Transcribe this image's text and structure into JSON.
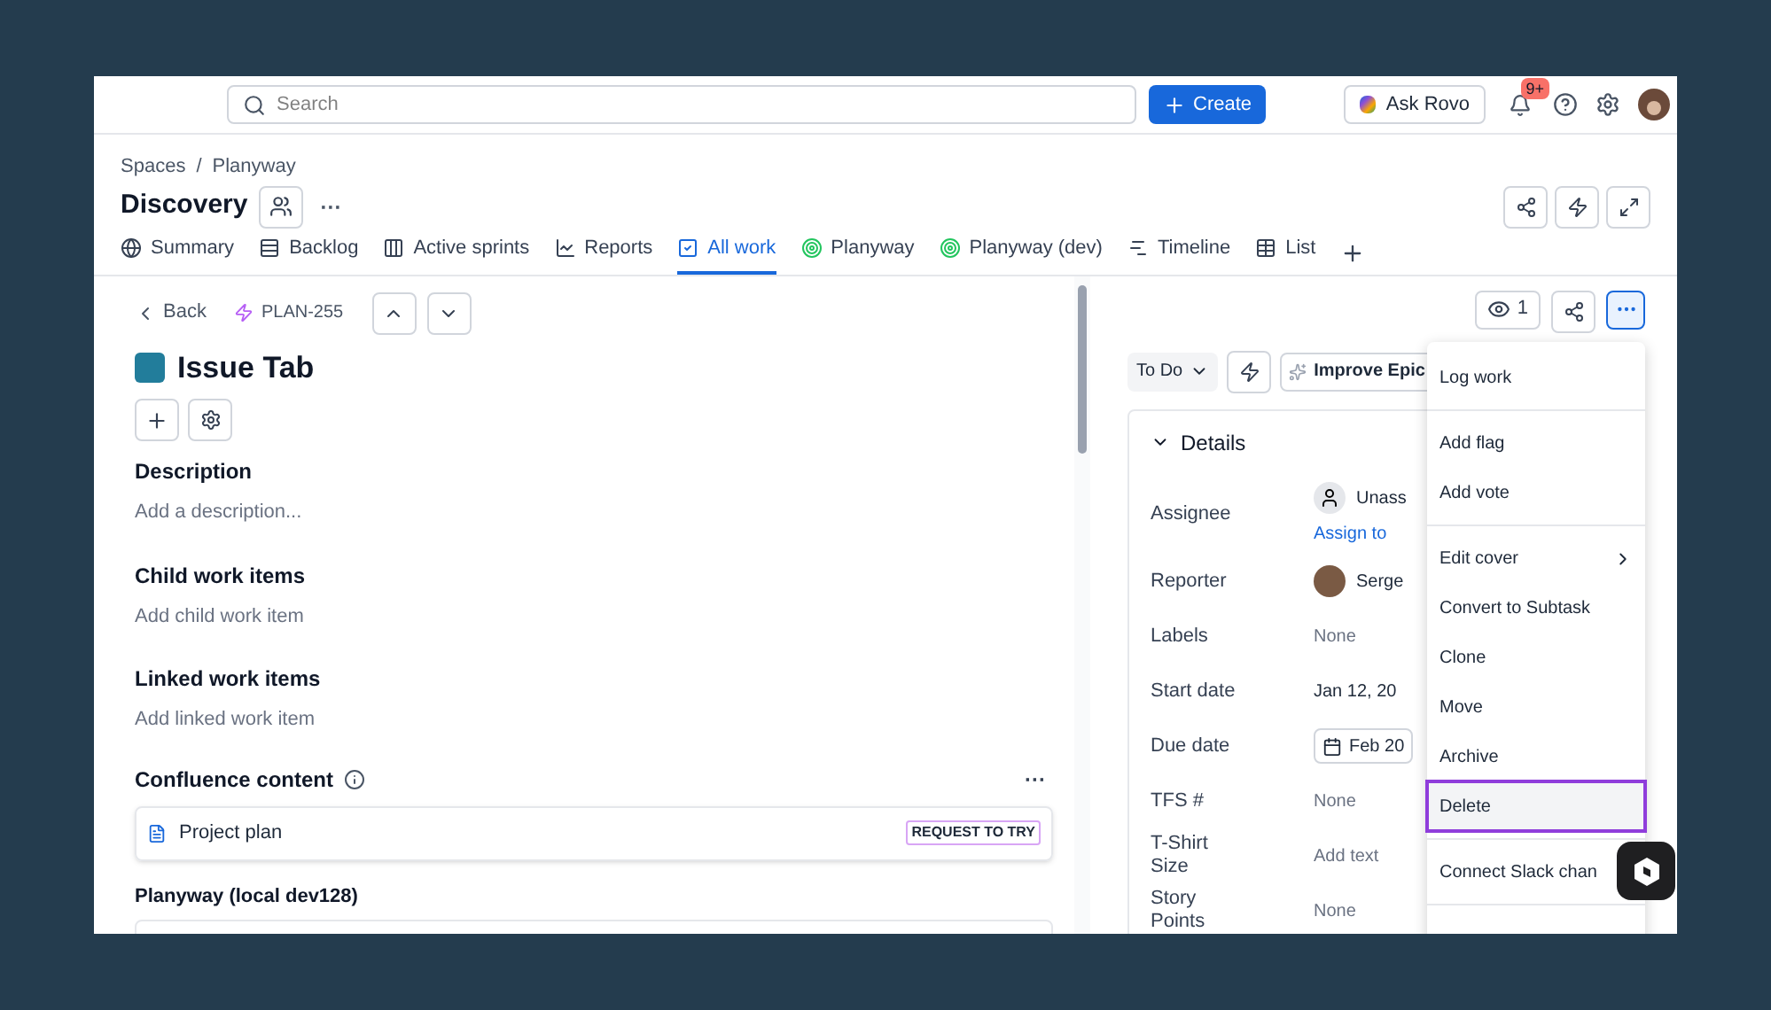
{
  "topbar": {
    "search": {
      "placeholder": "Search"
    },
    "create": "Create",
    "ask": "Ask Rovo",
    "notifications": "9+"
  },
  "breadcrumbs": [
    "Spaces",
    "/",
    "Planyway"
  ],
  "space": {
    "title": "Discovery",
    "more": "···"
  },
  "tabs": [
    {
      "label": "Summary",
      "selected": false
    },
    {
      "label": "Backlog",
      "selected": false
    },
    {
      "label": "Active sprints",
      "selected": false
    },
    {
      "label": "Reports",
      "selected": false
    },
    {
      "label": "All work",
      "selected": true
    },
    {
      "label": "Planyway",
      "selected": false
    },
    {
      "label": "Planyway (dev)",
      "selected": false
    },
    {
      "label": "Timeline",
      "selected": false
    },
    {
      "label": "List",
      "selected": false
    }
  ],
  "issue": {
    "back": "Back",
    "key": "PLAN-255",
    "title": "Issue Tab",
    "sections": [
      {
        "title": "Description",
        "hint": "Add a description..."
      },
      {
        "title": "Child work items",
        "hint": "Add child work item"
      },
      {
        "title": "Linked work items",
        "hint": "Add linked work item"
      }
    ],
    "confluence": {
      "title": "Confluence content",
      "more": "···",
      "page": "Project plan",
      "badge": "REQUEST TO TRY"
    },
    "planyway": {
      "title": "Planyway (local dev128)"
    }
  },
  "side": {
    "watchers": "1",
    "status": "To Do",
    "improve": "Improve Epic",
    "details_title": "Details",
    "expanded": true,
    "fields": [
      {
        "label": "Assignee",
        "kind": "user",
        "value": "Unass",
        "link": "Assign to"
      },
      {
        "label": "Reporter",
        "kind": "photo",
        "value": "Serge"
      },
      {
        "label": "Labels",
        "kind": "empty",
        "placeholder": "None"
      },
      {
        "label": "Start date",
        "kind": "text",
        "value": "Jan 12, 20"
      },
      {
        "label": "Due date",
        "kind": "date",
        "value": "Feb 20"
      },
      {
        "label": "TFS #",
        "kind": "empty",
        "placeholder": "None"
      },
      {
        "label": "T-Shirt Size",
        "kind": "empty",
        "placeholder": "Add text"
      },
      {
        "label": "Story Points",
        "kind": "empty",
        "placeholder": "None"
      }
    ]
  },
  "menu": [
    {
      "label": "Log work",
      "selected": false,
      "divider_after": true
    },
    {
      "label": "Add flag",
      "selected": false
    },
    {
      "label": "Add vote",
      "selected": false,
      "divider_after": true
    },
    {
      "label": "Edit cover",
      "selected": false,
      "submenu": true
    },
    {
      "label": "Convert to Subtask",
      "selected": false
    },
    {
      "label": "Clone",
      "selected": false
    },
    {
      "label": "Move",
      "selected": false
    },
    {
      "label": "Archive",
      "selected": false
    },
    {
      "label": "Delete",
      "selected": true,
      "divider_after": true
    },
    {
      "label": "Connect Slack chan",
      "selected": false,
      "divider_after": true
    }
  ]
}
